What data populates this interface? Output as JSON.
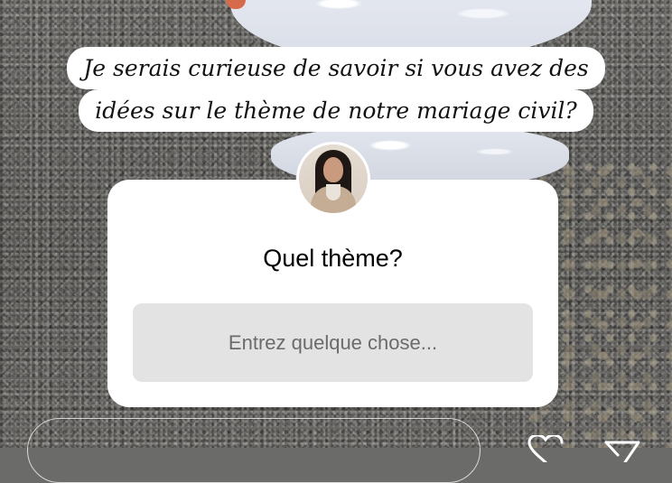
{
  "story": {
    "text_lines": [
      "Je serais curieuse de savoir si vous avez des",
      "idées sur le thème de notre mariage civil?"
    ]
  },
  "question_sticker": {
    "question": "Quel thème?",
    "answer_placeholder": "Entrez quelque chose..."
  },
  "icons": {
    "like": "heart-icon",
    "share": "send-icon"
  },
  "colors": {
    "sticker_background": "#ffffff",
    "answer_field": "#e3e3e3",
    "placeholder_text": "#6b6b6b"
  }
}
